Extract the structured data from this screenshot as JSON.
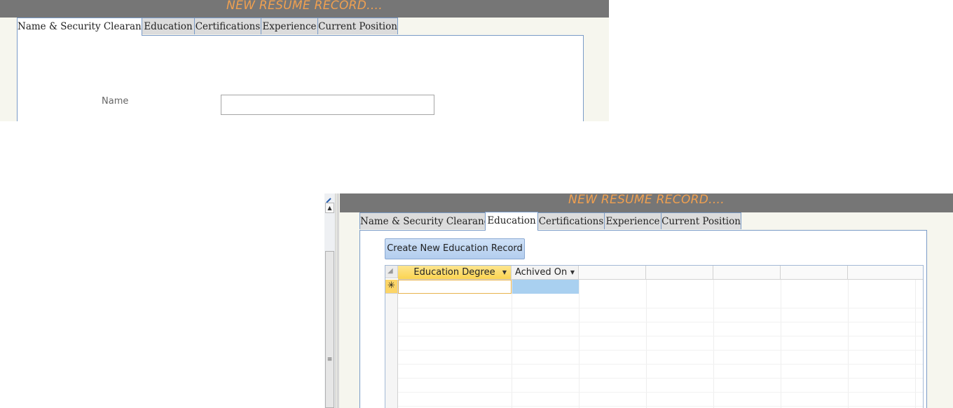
{
  "form_top": {
    "title": "NEW RESUME RECORD....",
    "tabs": [
      {
        "label": "Name & Security Clearance",
        "active": true
      },
      {
        "label": "Education",
        "active": false
      },
      {
        "label": "Certifications",
        "active": false
      },
      {
        "label": "Experience",
        "active": false
      },
      {
        "label": "Current Position",
        "active": false
      }
    ],
    "name_label": "Name",
    "name_value": ""
  },
  "form_bottom": {
    "title": "NEW RESUME RECORD....",
    "tabs": [
      {
        "label": "Name & Security Clearance",
        "active": false
      },
      {
        "label": "Education",
        "active": true
      },
      {
        "label": "Certifications",
        "active": false
      },
      {
        "label": "Experience",
        "active": false
      },
      {
        "label": "Current Position",
        "active": false
      }
    ],
    "create_button": "Create New Education Record",
    "datasheet": {
      "columns": [
        "Education Degree",
        "Achived On"
      ],
      "new_row_marker": "✳",
      "rows": []
    }
  },
  "icons": {
    "scroll_up": "arrow-up-icon",
    "grip": "scroll-grip-icon",
    "dropdown": "chevron-down-icon"
  },
  "colors": {
    "title_bar": "#767676",
    "title_text": "#f0a050",
    "tab_border": "#7a9bc7",
    "form_bg": "#f6f6ee",
    "header_highlight": "#fbd451",
    "selected_cell": "#a9d0f0"
  }
}
